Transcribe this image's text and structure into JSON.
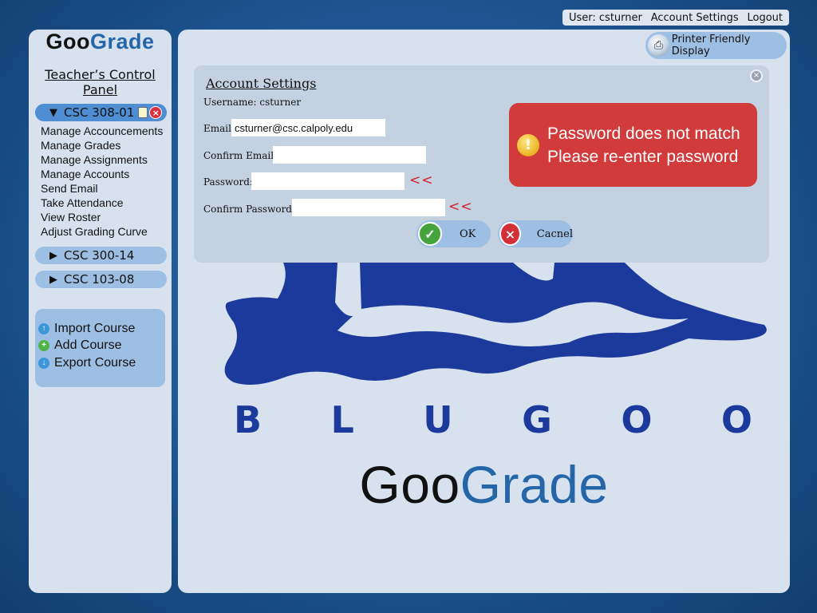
{
  "topbar": {
    "user": "User: csturner",
    "account_settings": "Account Settings",
    "logout": "Logout"
  },
  "sidebar": {
    "logo_part1": "Goo",
    "logo_part2": "Grade",
    "panel_title": "Teacher’s Control Panel",
    "courses": [
      {
        "code": "CSC 308-01",
        "expanded": true
      },
      {
        "code": "CSC 300-14",
        "expanded": false
      },
      {
        "code": "CSC 103-08",
        "expanded": false
      }
    ],
    "menu": [
      "Manage Accouncements",
      "Manage Grades",
      "Manage Assignments",
      "Manage Accounts",
      "Send Email",
      "Take Attendance",
      "View Roster",
      "Adjust Grading Curve"
    ],
    "tools": {
      "import": "Import Course",
      "add": "Add Course",
      "export": "Export Course"
    }
  },
  "main": {
    "printer_label": "Printer Friendly Display",
    "dialog": {
      "title": "Account Settings",
      "username_label": "Username:",
      "username_value": "csturner",
      "email_label": "Email:",
      "email_value": "csturner@csc.calpoly.edu",
      "confirm_email_label": "Confirm Email:",
      "confirm_email_value": "",
      "password_label": "Password:",
      "password_value": "",
      "confirm_password_label": "Confirm Password:",
      "confirm_password_value": "",
      "error_marker": "<<",
      "ok_label": "OK",
      "cancel_label": "Cacnel",
      "alert_line1": "Password does not match",
      "alert_line2": "Please re-enter password"
    },
    "splash": {
      "brand_letters": [
        "B",
        "L",
        "U",
        "G",
        "O",
        "O"
      ],
      "logo_part1": "Goo",
      "logo_part2": "Grade"
    }
  },
  "colors": {
    "background": "#1d5592",
    "panel": "#d7e2ee",
    "pill": "#9ebfe4",
    "pill_active": "#4f8ed3",
    "alert": "#d13b3c",
    "brand_blue": "#2466a8",
    "splash_blue": "#1c3a9c"
  }
}
